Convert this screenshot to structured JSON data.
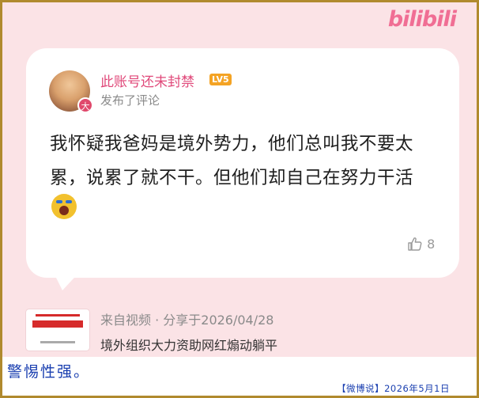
{
  "brand": {
    "logo_text": "bilibili"
  },
  "comment_card": {
    "username": "此账号还未封禁",
    "level_badge": "LV5",
    "avatar_badge": "大",
    "action_text": "发布了评论",
    "text": "我怀疑我爸妈是境外势力，他们总叫我不要太累，说累了就不干。但他们却自己在努力干活",
    "like_count": "8",
    "emoji_icon": "crying-emoji-icon"
  },
  "shared_video": {
    "source_line": "来自视频 · 分享于2026/04/28",
    "title": "境外组织大力资助网红煽动躺平"
  },
  "footer": {
    "caption": "警惕性强。",
    "credit": "【微博说】2026年5月1日"
  },
  "colors": {
    "background_pink": "#fbe3e6",
    "username_pink": "#e0497a",
    "level_orange": "#f4a324",
    "caption_blue": "#1a3fb0",
    "frame_gold": "#b08a2e"
  }
}
